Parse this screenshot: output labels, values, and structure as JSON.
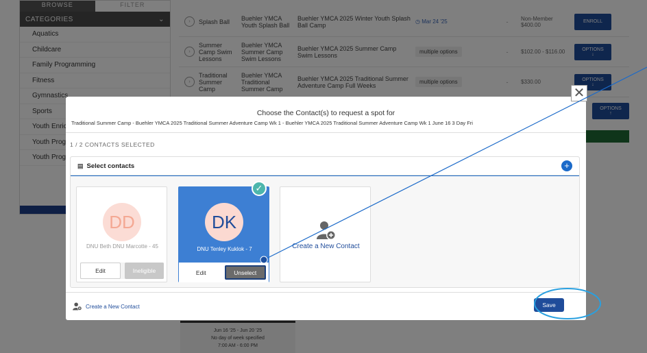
{
  "sidebar": {
    "tabs": [
      "BROWSE",
      "FILTER"
    ],
    "categories_label": "CATEGORIES",
    "items": [
      "Aquatics",
      "Childcare",
      "Family Programming",
      "Fitness",
      "Gymnastics",
      "Sports",
      "Youth Enrichm",
      "Youth Progra",
      "Youth Progra"
    ]
  },
  "rows": [
    {
      "c1": "Splash Ball",
      "c2": "Buehler YMCA Youth Splash Ball",
      "c3": "Buehler YMCA 2025 Winter Youth Splash Ball Camp",
      "c4": "Mar 24 '25",
      "c5": "-",
      "c6": "Non-Member $400.00",
      "btn": "ENROLL"
    },
    {
      "c1": "Summer Camp Swim Lessons",
      "c2": "Buehler YMCA Summer Camp Swim Lessons",
      "c3": "Buehler YMCA 2025 Summer Camp Swim Lessons",
      "c4": "multiple options",
      "c5": "-",
      "c6": "$102.00 - $116.00",
      "btn": "OPTIONS"
    },
    {
      "c1": "Traditional Summer Camp",
      "c2": "Buehler YMCA Traditional Summer Camp",
      "c3": "Buehler YMCA 2025 Traditional Summer Adventure Camp Full Weeks",
      "c4": "multiple options",
      "c5": "-",
      "c6": "$330.00",
      "btn": "OPTIONS"
    }
  ],
  "row4_btn": "OPTIONS",
  "date_card": {
    "dates": "Jun 16 '25 - Jun 20 '25",
    "days": "No day of week specified",
    "time": "7:00 AM - 6:00 PM"
  },
  "modal": {
    "close": "✕",
    "title": "Choose the Contact(s) to request a spot for",
    "subtitle": "Traditional Summer Camp - Buehler YMCA 2025 Traditional Summer Adventure Camp Wk 1 - Buehler YMCA 2025 Traditional Summer Adventure Camp Wk 1 June 16 3 Day Fri",
    "count": "1 / 2 CONTACTS SELECTED",
    "panel_title": "Select contacts",
    "contacts": [
      {
        "initials": "DD",
        "name": "DNU Beth DNU Marcotte",
        "age": "- 45",
        "edit": "Edit",
        "action": "Ineligible"
      },
      {
        "initials": "DK",
        "name": "DNU Tenley Kuklok - 7",
        "edit": "Edit",
        "action": "Unselect"
      }
    ],
    "create_card": "Create a New Contact",
    "footer_create": "Create a New Contact",
    "save": "Save"
  },
  "colors": {
    "primary": "#1f4c9a",
    "selected_card": "#3d7fd3",
    "check": "#4db6ac",
    "annotation": "#1b6ac9"
  }
}
